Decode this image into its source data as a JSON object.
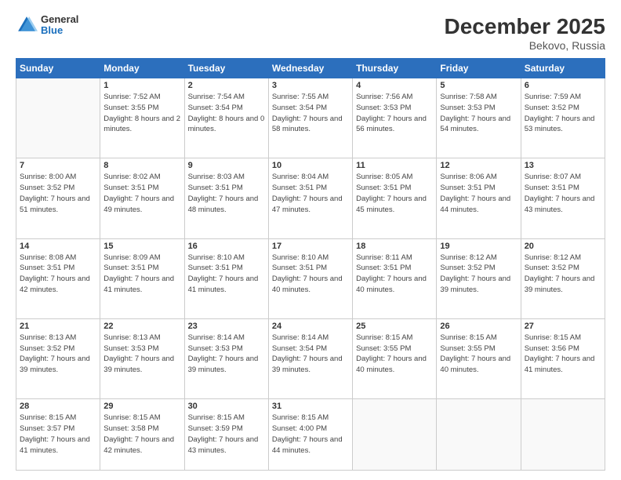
{
  "header": {
    "logo_general": "General",
    "logo_blue": "Blue",
    "month_year": "December 2025",
    "location": "Bekovo, Russia"
  },
  "weekdays": [
    "Sunday",
    "Monday",
    "Tuesday",
    "Wednesday",
    "Thursday",
    "Friday",
    "Saturday"
  ],
  "weeks": [
    [
      {
        "day": "",
        "sunrise": "",
        "sunset": "",
        "daylight": "",
        "empty": true
      },
      {
        "day": "1",
        "sunrise": "Sunrise: 7:52 AM",
        "sunset": "Sunset: 3:55 PM",
        "daylight": "Daylight: 8 hours and 2 minutes.",
        "empty": false
      },
      {
        "day": "2",
        "sunrise": "Sunrise: 7:54 AM",
        "sunset": "Sunset: 3:54 PM",
        "daylight": "Daylight: 8 hours and 0 minutes.",
        "empty": false
      },
      {
        "day": "3",
        "sunrise": "Sunrise: 7:55 AM",
        "sunset": "Sunset: 3:54 PM",
        "daylight": "Daylight: 7 hours and 58 minutes.",
        "empty": false
      },
      {
        "day": "4",
        "sunrise": "Sunrise: 7:56 AM",
        "sunset": "Sunset: 3:53 PM",
        "daylight": "Daylight: 7 hours and 56 minutes.",
        "empty": false
      },
      {
        "day": "5",
        "sunrise": "Sunrise: 7:58 AM",
        "sunset": "Sunset: 3:53 PM",
        "daylight": "Daylight: 7 hours and 54 minutes.",
        "empty": false
      },
      {
        "day": "6",
        "sunrise": "Sunrise: 7:59 AM",
        "sunset": "Sunset: 3:52 PM",
        "daylight": "Daylight: 7 hours and 53 minutes.",
        "empty": false
      }
    ],
    [
      {
        "day": "7",
        "sunrise": "Sunrise: 8:00 AM",
        "sunset": "Sunset: 3:52 PM",
        "daylight": "Daylight: 7 hours and 51 minutes.",
        "empty": false
      },
      {
        "day": "8",
        "sunrise": "Sunrise: 8:02 AM",
        "sunset": "Sunset: 3:51 PM",
        "daylight": "Daylight: 7 hours and 49 minutes.",
        "empty": false
      },
      {
        "day": "9",
        "sunrise": "Sunrise: 8:03 AM",
        "sunset": "Sunset: 3:51 PM",
        "daylight": "Daylight: 7 hours and 48 minutes.",
        "empty": false
      },
      {
        "day": "10",
        "sunrise": "Sunrise: 8:04 AM",
        "sunset": "Sunset: 3:51 PM",
        "daylight": "Daylight: 7 hours and 47 minutes.",
        "empty": false
      },
      {
        "day": "11",
        "sunrise": "Sunrise: 8:05 AM",
        "sunset": "Sunset: 3:51 PM",
        "daylight": "Daylight: 7 hours and 45 minutes.",
        "empty": false
      },
      {
        "day": "12",
        "sunrise": "Sunrise: 8:06 AM",
        "sunset": "Sunset: 3:51 PM",
        "daylight": "Daylight: 7 hours and 44 minutes.",
        "empty": false
      },
      {
        "day": "13",
        "sunrise": "Sunrise: 8:07 AM",
        "sunset": "Sunset: 3:51 PM",
        "daylight": "Daylight: 7 hours and 43 minutes.",
        "empty": false
      }
    ],
    [
      {
        "day": "14",
        "sunrise": "Sunrise: 8:08 AM",
        "sunset": "Sunset: 3:51 PM",
        "daylight": "Daylight: 7 hours and 42 minutes.",
        "empty": false
      },
      {
        "day": "15",
        "sunrise": "Sunrise: 8:09 AM",
        "sunset": "Sunset: 3:51 PM",
        "daylight": "Daylight: 7 hours and 41 minutes.",
        "empty": false
      },
      {
        "day": "16",
        "sunrise": "Sunrise: 8:10 AM",
        "sunset": "Sunset: 3:51 PM",
        "daylight": "Daylight: 7 hours and 41 minutes.",
        "empty": false
      },
      {
        "day": "17",
        "sunrise": "Sunrise: 8:10 AM",
        "sunset": "Sunset: 3:51 PM",
        "daylight": "Daylight: 7 hours and 40 minutes.",
        "empty": false
      },
      {
        "day": "18",
        "sunrise": "Sunrise: 8:11 AM",
        "sunset": "Sunset: 3:51 PM",
        "daylight": "Daylight: 7 hours and 40 minutes.",
        "empty": false
      },
      {
        "day": "19",
        "sunrise": "Sunrise: 8:12 AM",
        "sunset": "Sunset: 3:52 PM",
        "daylight": "Daylight: 7 hours and 39 minutes.",
        "empty": false
      },
      {
        "day": "20",
        "sunrise": "Sunrise: 8:12 AM",
        "sunset": "Sunset: 3:52 PM",
        "daylight": "Daylight: 7 hours and 39 minutes.",
        "empty": false
      }
    ],
    [
      {
        "day": "21",
        "sunrise": "Sunrise: 8:13 AM",
        "sunset": "Sunset: 3:52 PM",
        "daylight": "Daylight: 7 hours and 39 minutes.",
        "empty": false
      },
      {
        "day": "22",
        "sunrise": "Sunrise: 8:13 AM",
        "sunset": "Sunset: 3:53 PM",
        "daylight": "Daylight: 7 hours and 39 minutes.",
        "empty": false
      },
      {
        "day": "23",
        "sunrise": "Sunrise: 8:14 AM",
        "sunset": "Sunset: 3:53 PM",
        "daylight": "Daylight: 7 hours and 39 minutes.",
        "empty": false
      },
      {
        "day": "24",
        "sunrise": "Sunrise: 8:14 AM",
        "sunset": "Sunset: 3:54 PM",
        "daylight": "Daylight: 7 hours and 39 minutes.",
        "empty": false
      },
      {
        "day": "25",
        "sunrise": "Sunrise: 8:15 AM",
        "sunset": "Sunset: 3:55 PM",
        "daylight": "Daylight: 7 hours and 40 minutes.",
        "empty": false
      },
      {
        "day": "26",
        "sunrise": "Sunrise: 8:15 AM",
        "sunset": "Sunset: 3:55 PM",
        "daylight": "Daylight: 7 hours and 40 minutes.",
        "empty": false
      },
      {
        "day": "27",
        "sunrise": "Sunrise: 8:15 AM",
        "sunset": "Sunset: 3:56 PM",
        "daylight": "Daylight: 7 hours and 41 minutes.",
        "empty": false
      }
    ],
    [
      {
        "day": "28",
        "sunrise": "Sunrise: 8:15 AM",
        "sunset": "Sunset: 3:57 PM",
        "daylight": "Daylight: 7 hours and 41 minutes.",
        "empty": false
      },
      {
        "day": "29",
        "sunrise": "Sunrise: 8:15 AM",
        "sunset": "Sunset: 3:58 PM",
        "daylight": "Daylight: 7 hours and 42 minutes.",
        "empty": false
      },
      {
        "day": "30",
        "sunrise": "Sunrise: 8:15 AM",
        "sunset": "Sunset: 3:59 PM",
        "daylight": "Daylight: 7 hours and 43 minutes.",
        "empty": false
      },
      {
        "day": "31",
        "sunrise": "Sunrise: 8:15 AM",
        "sunset": "Sunset: 4:00 PM",
        "daylight": "Daylight: 7 hours and 44 minutes.",
        "empty": false
      },
      {
        "day": "",
        "sunrise": "",
        "sunset": "",
        "daylight": "",
        "empty": true
      },
      {
        "day": "",
        "sunrise": "",
        "sunset": "",
        "daylight": "",
        "empty": true
      },
      {
        "day": "",
        "sunrise": "",
        "sunset": "",
        "daylight": "",
        "empty": true
      }
    ]
  ]
}
